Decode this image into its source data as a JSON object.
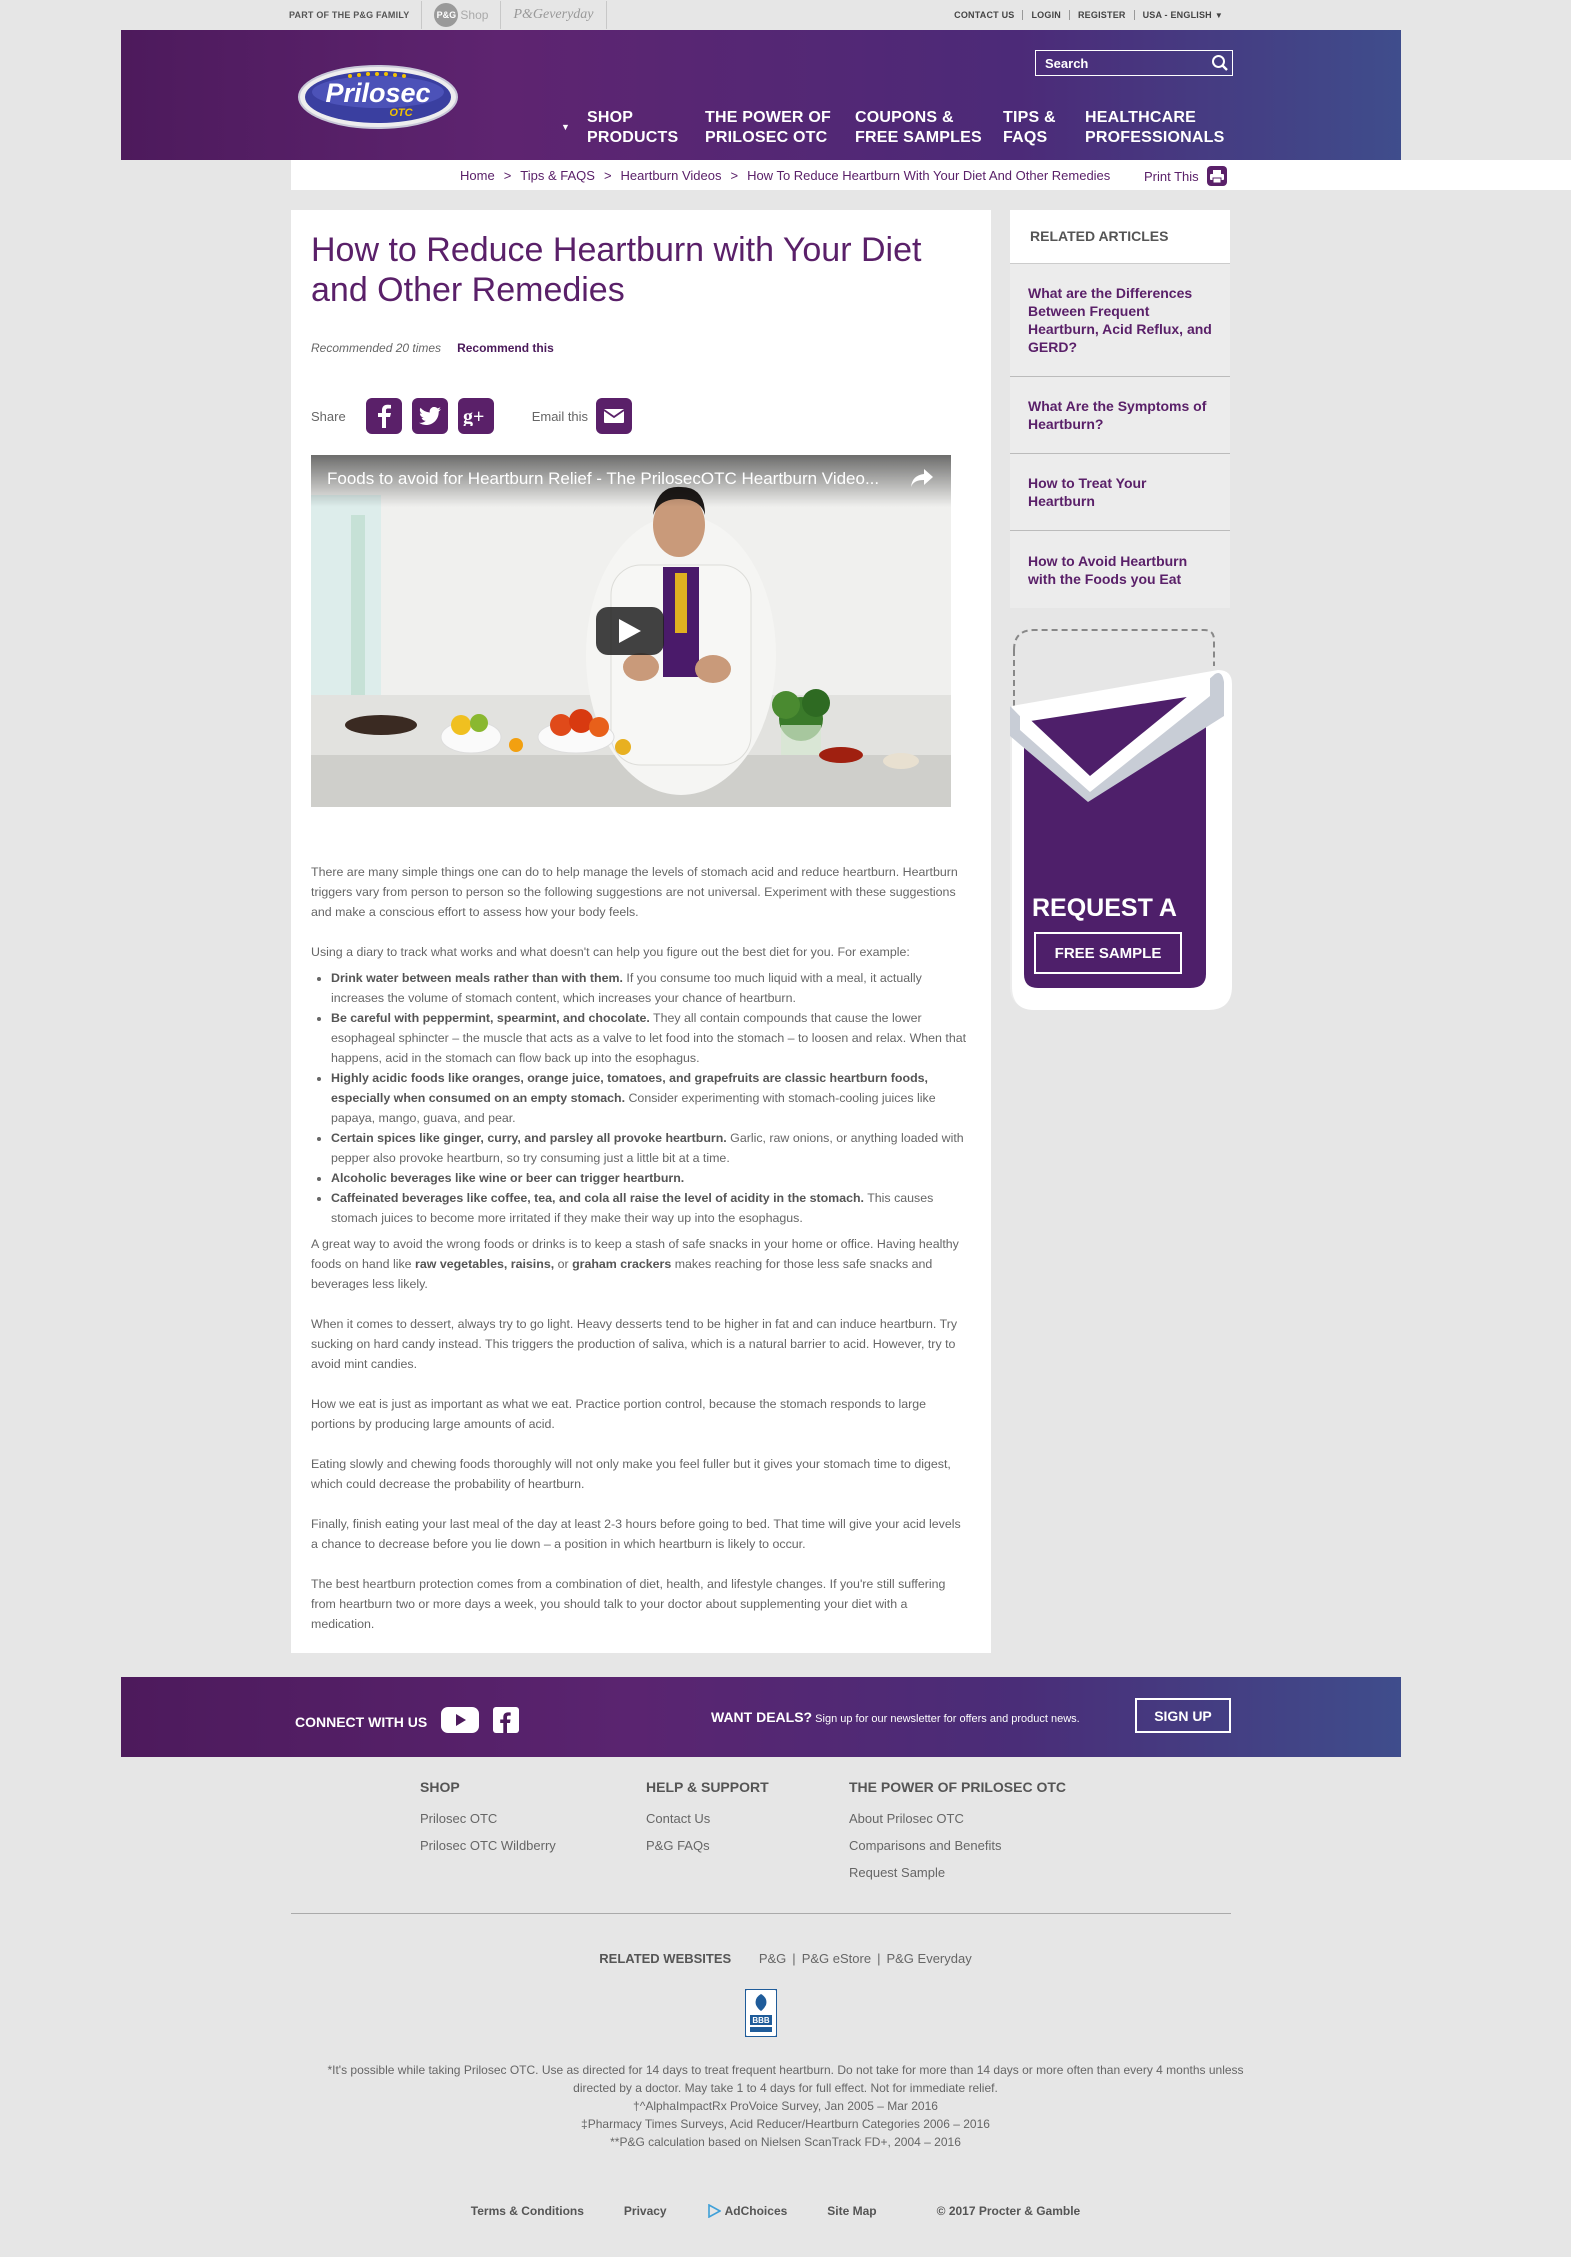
{
  "utility": {
    "pg_family": "PART OF THE P&G FAMILY",
    "pg_shop": "Shop",
    "pg_shop_logo": "P&G",
    "pg_everyday": "P&Geveryday",
    "contact": "CONTACT US",
    "login": "LOGIN",
    "register": "REGISTER",
    "locale": "USA - ENGLISH"
  },
  "header": {
    "logo_text": "Prilosec",
    "logo_sub": "OTC",
    "search_placeholder": "Search",
    "nav": [
      {
        "line1": "SHOP",
        "line2": "PRODUCTS"
      },
      {
        "line1": "THE POWER OF",
        "line2": "PRILOSEC OTC"
      },
      {
        "line1": "COUPONS &",
        "line2": "FREE SAMPLES"
      },
      {
        "line1": "TIPS &",
        "line2": "FAQS"
      },
      {
        "line1": "HEALTHCARE",
        "line2": "PROFESSIONALS"
      }
    ]
  },
  "breadcrumb": {
    "items": [
      "Home",
      "Tips & FAQS",
      "Heartburn Videos",
      "How To Reduce Heartburn With Your Diet And Other Remedies"
    ],
    "separator": ">",
    "print": "Print This"
  },
  "article": {
    "title": "How to Reduce Heartburn with Your Diet and Other Remedies",
    "recommended": "Recommended 20 times",
    "recommend_btn": "Recommend this",
    "share_label": "Share",
    "email_label": "Email this",
    "video_title": "Foods to avoid for Heartburn Relief - The PrilosecOTC Heartburn Video...",
    "intro": "There are many simple things one can do to help manage the levels of stomach acid and reduce heartburn. Heartburn triggers vary from person to person so the following suggestions are not universal. Experiment with these suggestions and make a conscious effort to assess how your body feels.",
    "diary": "Using a diary to track what works and what doesn't can help you figure out the best diet for you. For example:",
    "bullets": [
      {
        "bold": "Drink water between meals rather than with them.",
        "text": " If you consume too much liquid with a meal, it actually increases the volume of stomach content, which increases your chance of heartburn."
      },
      {
        "bold": "Be careful with peppermint, spearmint, and chocolate.",
        "text": " They all contain compounds that cause the lower esophageal sphincter – the muscle that acts as a valve to let food into the stomach – to loosen and relax. When that happens, acid in the stomach can flow back up into the esophagus."
      },
      {
        "bold": "Highly acidic foods like oranges, orange juice, tomatoes, and grapefruits are classic heartburn foods, especially when consumed on an empty stomach.",
        "text": " Consider experimenting with stomach-cooling juices like papaya, mango, guava, and pear."
      },
      {
        "bold": "Certain spices like ginger, curry, and parsley all provoke heartburn.",
        "text": " Garlic, raw onions, or anything loaded with pepper also provoke heartburn, so try consuming just a little bit at a time."
      },
      {
        "bold": "Alcoholic beverages like wine or beer can trigger heartburn.",
        "text": ""
      },
      {
        "bold": "Caffeinated beverages like coffee, tea, and cola all raise the level of acidity in the stomach.",
        "text": " This causes stomach juices to become more irritated if they make their way up into the esophagus."
      }
    ],
    "snacks_pre": "A great way to avoid the wrong foods or drinks is to keep a stash of safe snacks in your home or office. Having healthy foods on hand like ",
    "snacks_b1": "raw vegetables, raisins,",
    "snacks_mid": " or ",
    "snacks_b2": "graham crackers",
    "snacks_post": " makes reaching for those less safe snacks and beverages less likely.",
    "p_dessert": "When it comes to dessert, always try to go light. Heavy desserts tend to be higher in fat and can induce heartburn. Try sucking on hard candy instead. This triggers the production of saliva, which is a natural barrier to acid. However, try to avoid mint candies.",
    "p_howweeat": "How we eat is just as important as what we eat. Practice portion control, because the stomach responds to large portions by producing large amounts of acid.",
    "p_slowly": "Eating slowly and chewing foods thoroughly will not only make you feel fuller but it gives your stomach time to digest, which could decrease the probability of heartburn.",
    "p_finally": "Finally, finish eating your last meal of the day at least 2-3 hours before going to bed. That time will give your acid levels a chance to decrease before you lie down – a position in which heartburn is likely to occur.",
    "p_best": "The best heartburn protection comes from a combination of diet, health, and lifestyle changes. If you're still suffering from heartburn two or more days a week, you should talk to your doctor about supplementing your diet with a medication."
  },
  "sidebar": {
    "heading": "RELATED ARTICLES",
    "items": [
      "What are the Differences Between Frequent Heartburn, Acid Reflux, and GERD?",
      "What Are the Symptoms of Heartburn?",
      "How to Treat Your Heartburn",
      "How to Avoid Heartburn with the Foods you Eat"
    ],
    "sample_title": "REQUEST A",
    "sample_btn": "FREE SAMPLE"
  },
  "footer": {
    "connect": "CONNECT WITH US",
    "deals_bold": "WANT DEALS?",
    "deals_text": " Sign up for our newsletter for offers and product news.",
    "signup": "SIGN UP",
    "cols": [
      {
        "title": "SHOP",
        "links": [
          "Prilosec OTC",
          "Prilosec OTC Wildberry"
        ]
      },
      {
        "title": "HELP & SUPPORT",
        "links": [
          "Contact Us",
          "P&G FAQs"
        ]
      },
      {
        "title": "THE POWER OF PRILOSEC OTC",
        "links": [
          "About Prilosec OTC",
          "Comparisons and Benefits",
          "Request Sample"
        ]
      }
    ],
    "related_label": "RELATED WEBSITES",
    "related_sites": [
      "P&G",
      "P&G eStore",
      "P&G Everyday"
    ],
    "bbb": "BBB",
    "disclaimer_1": "*It's possible while taking Prilosec OTC. Use as directed for 14 days to treat frequent heartburn. Do not take for more than 14 days or more often than every 4 months unless directed by a doctor. May take 1 to 4 days for full effect. Not for immediate relief.",
    "disclaimer_2": "†^AlphaImpactRx ProVoice Survey, Jan 2005 – Mar 2016",
    "disclaimer_3": "‡Pharmacy Times Surveys, Acid Reducer/Heartburn Categories 2006 – 2016",
    "disclaimer_4": "**P&G calculation based on Nielsen ScanTrack FD+, 2004 – 2016",
    "bottom": [
      "Terms & Conditions",
      "Privacy",
      "AdChoices",
      "Site Map",
      "© 2017 Procter & Gamble"
    ]
  }
}
